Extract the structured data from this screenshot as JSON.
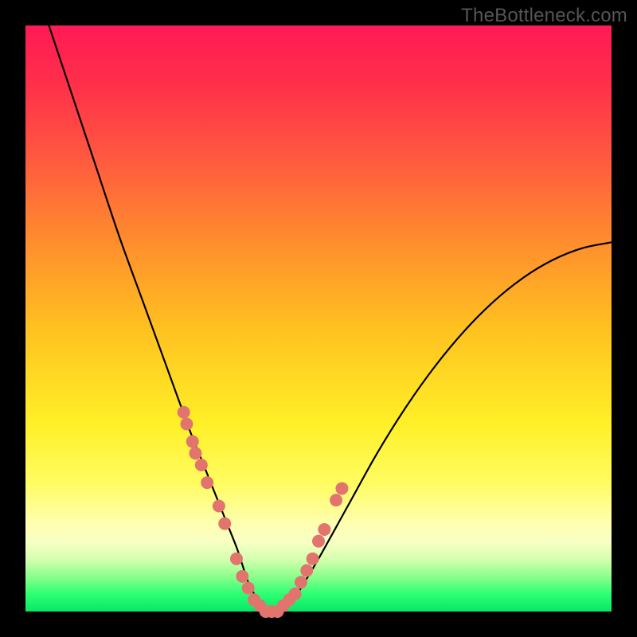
{
  "watermark": "TheBottleneck.com",
  "chart_data": {
    "type": "line",
    "title": "",
    "xlabel": "",
    "ylabel": "",
    "xlim": [
      0,
      100
    ],
    "ylim": [
      0,
      100
    ],
    "series": [
      {
        "name": "bottleneck-curve",
        "x": [
          4,
          8,
          12,
          16,
          20,
          24,
          28,
          30,
          32,
          34,
          36,
          37,
          38,
          39,
          40,
          41,
          42,
          43,
          45,
          47,
          50,
          55,
          60,
          65,
          70,
          75,
          80,
          85,
          90,
          95,
          100
        ],
        "values": [
          100,
          88,
          76,
          64,
          53,
          42,
          31,
          26,
          21,
          16,
          11,
          8,
          5,
          3,
          1,
          0,
          0,
          0,
          1,
          4,
          9,
          18,
          27,
          35,
          42,
          48,
          53,
          57,
          60,
          62,
          63
        ]
      }
    ],
    "markers": {
      "name": "highlight-points",
      "color": "#e2746e",
      "x": [
        27,
        27.5,
        28.5,
        29,
        30,
        31,
        33,
        34,
        36,
        37,
        38,
        39,
        40,
        41,
        42,
        43,
        44,
        45,
        46,
        47,
        48,
        49,
        50,
        51,
        53,
        54
      ],
      "values": [
        34,
        32,
        29,
        27,
        25,
        22,
        18,
        15,
        9,
        6,
        4,
        2,
        1,
        0,
        0,
        0,
        1,
        2,
        3,
        5,
        7,
        9,
        12,
        14,
        19,
        21
      ]
    },
    "background_gradient": {
      "top": "#ff1a55",
      "upper_mid": "#ff8a2e",
      "mid": "#fff028",
      "lower_mid": "#ffffb0",
      "bottom": "#06e765"
    }
  }
}
